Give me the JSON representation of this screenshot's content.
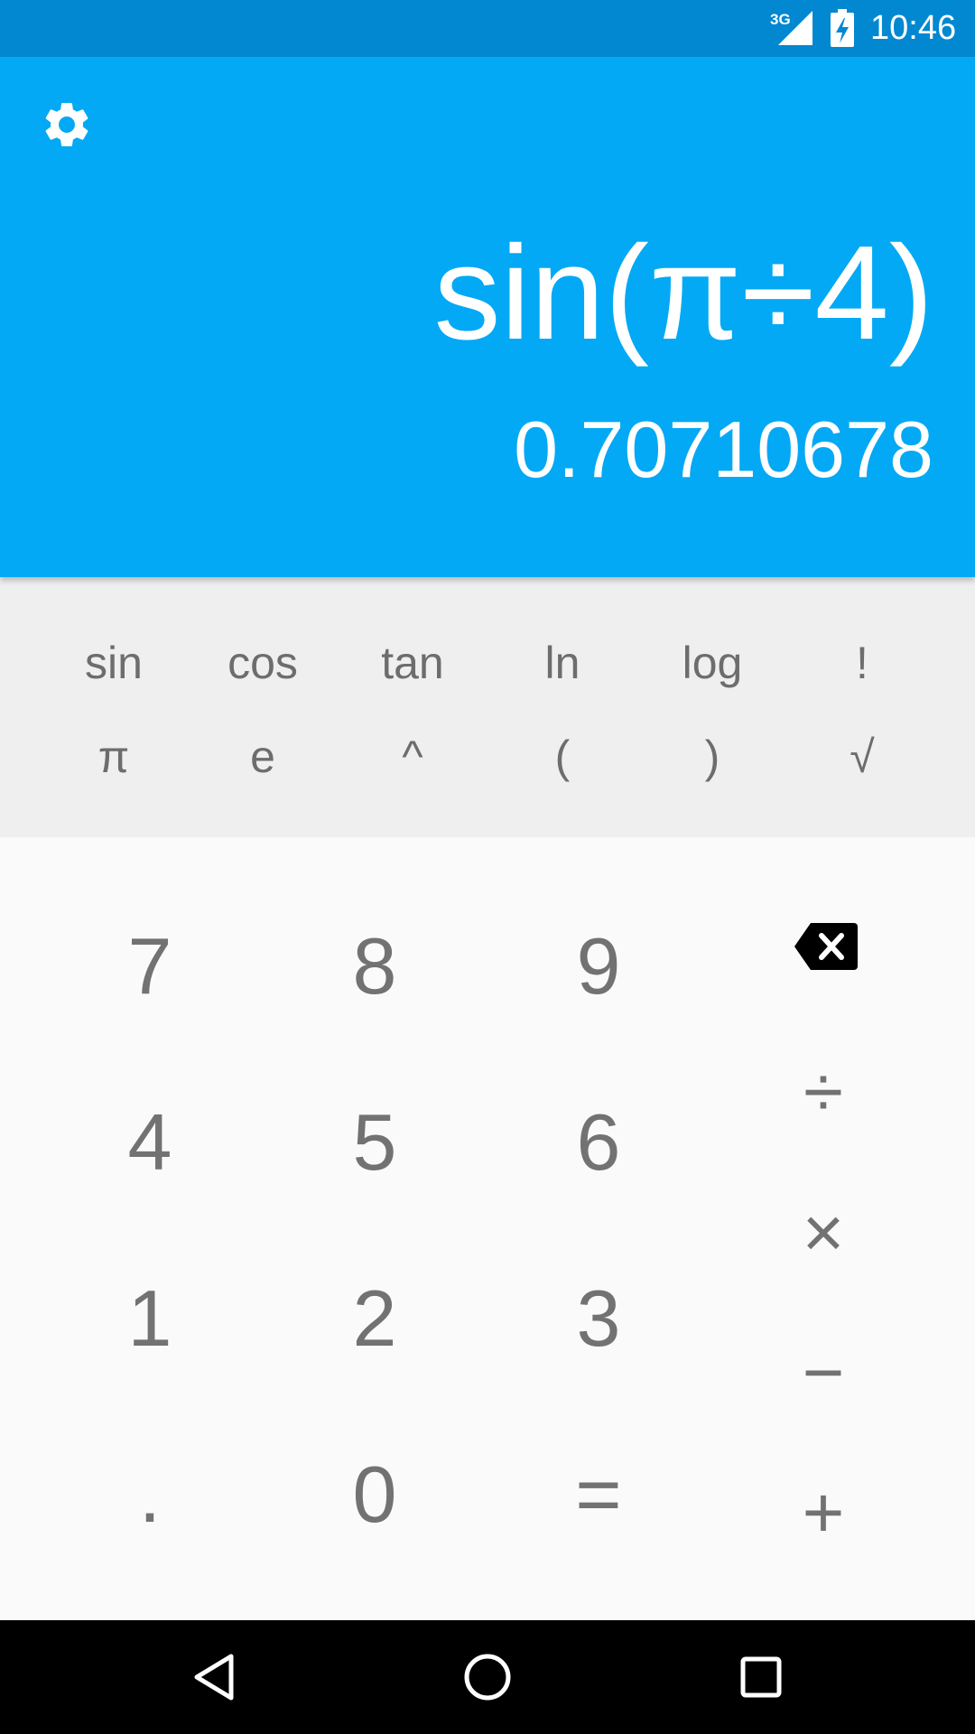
{
  "status_bar": {
    "network": "3G",
    "time": "10:46"
  },
  "display": {
    "expression": "sin(π÷4)",
    "result": "0.70710678"
  },
  "advanced_pad": {
    "row1": [
      "sin",
      "cos",
      "tan",
      "ln",
      "log",
      "!"
    ],
    "row2": [
      "π",
      "e",
      "^",
      "(",
      ")",
      "√"
    ]
  },
  "number_pad": {
    "digits": [
      "7",
      "8",
      "9",
      "4",
      "5",
      "6",
      "1",
      "2",
      "3",
      ".",
      "0",
      "="
    ],
    "operators": [
      "÷",
      "×",
      "−",
      "+"
    ]
  },
  "icons": {
    "settings": "gear-icon",
    "backspace": "backspace-icon",
    "nav_back": "back-triangle-icon",
    "nav_home": "home-circle-icon",
    "nav_recents": "recents-square-icon"
  },
  "colors": {
    "status_bar": "#0288d1",
    "display": "#03a9f4",
    "advanced_pad": "#efefef",
    "number_pad": "#fafafa",
    "key_text": "#727272"
  }
}
